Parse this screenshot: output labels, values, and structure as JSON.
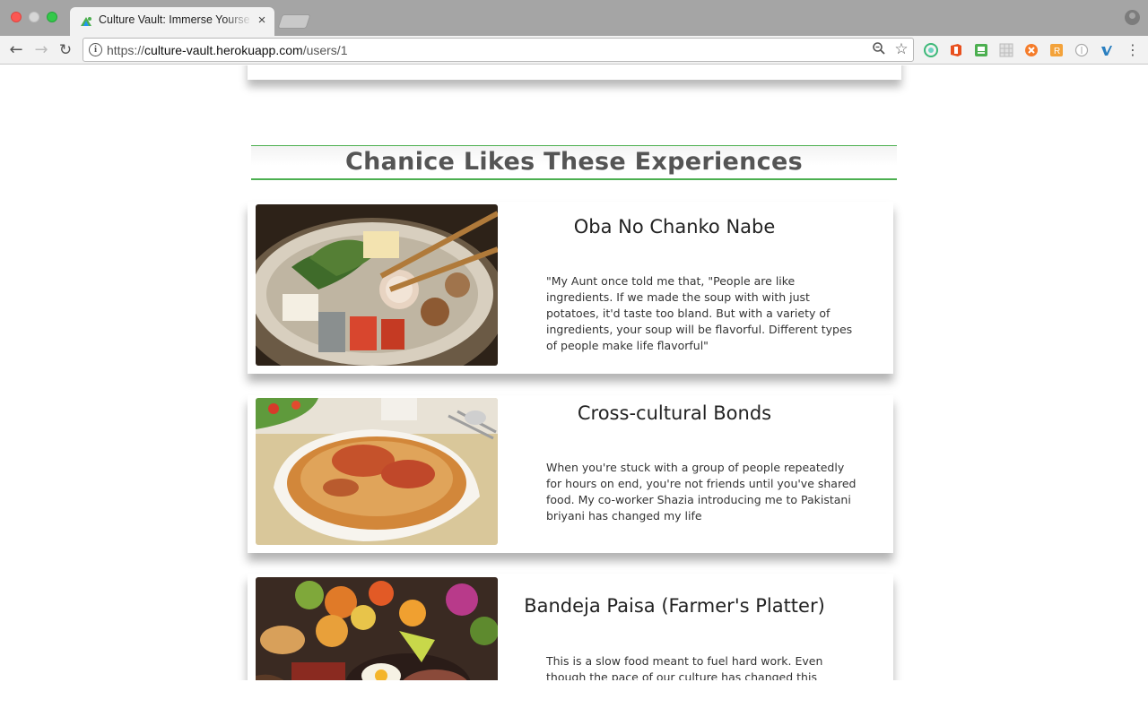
{
  "browser": {
    "tab_title": "Culture Vault: Immerse Yourself",
    "tab_close": "×",
    "url_scheme": "https://",
    "url_host": "culture-vault.herokuapp.com",
    "url_path": "/users/1",
    "icons": {
      "back": "back-arrow-icon",
      "forward": "forward-arrow-icon",
      "reload": "reload-icon",
      "info": "info-icon",
      "zoom": "zoom-icon",
      "bookmark": "star-icon",
      "menu": "menu-dots-icon",
      "profile": "profile-icon"
    },
    "extensions": [
      {
        "name": "extension-1-icon",
        "color": "#3cb878"
      },
      {
        "name": "office-extension-icon",
        "color": "#e8501e"
      },
      {
        "name": "print-extension-icon",
        "color": "#4caf50"
      },
      {
        "name": "grid-extension-icon",
        "color": "#cfcfcf"
      },
      {
        "name": "orange-extension-icon",
        "color": "#f57c2a"
      },
      {
        "name": "reader-extension-icon",
        "color": "#f3a23a"
      },
      {
        "name": "circle-extension-icon",
        "color": "#d0d0d0"
      },
      {
        "name": "vimeo-extension-icon",
        "color": "#2a7fc0"
      }
    ]
  },
  "page": {
    "section_title": "Chanice Likes These Experiences",
    "accent_color": "#4caf50",
    "experiences": [
      {
        "title": "Oba No Chanko Nabe",
        "text": "\"My Aunt once told me that, \"People are like ingredients. If we made the soup with with just potatoes, it'd taste too bland. But with a variety of ingredients, your soup will be flavorful. Different types of people make life flavorful\"",
        "image": "hot-pot-photo"
      },
      {
        "title": "Cross-cultural Bonds",
        "text": "When you're stuck with a group of people repeatedly for hours on end, you're not friends until you've shared food. My co-worker Shazia introducing me to Pakistani briyani has changed my life",
        "image": "biryani-photo"
      },
      {
        "title": "Bandeja Paisa (Farmer's Platter)",
        "text": "This is a slow food meant to fuel hard work. Even though the pace of our culture has changed this",
        "image": "platter-photo"
      }
    ]
  }
}
